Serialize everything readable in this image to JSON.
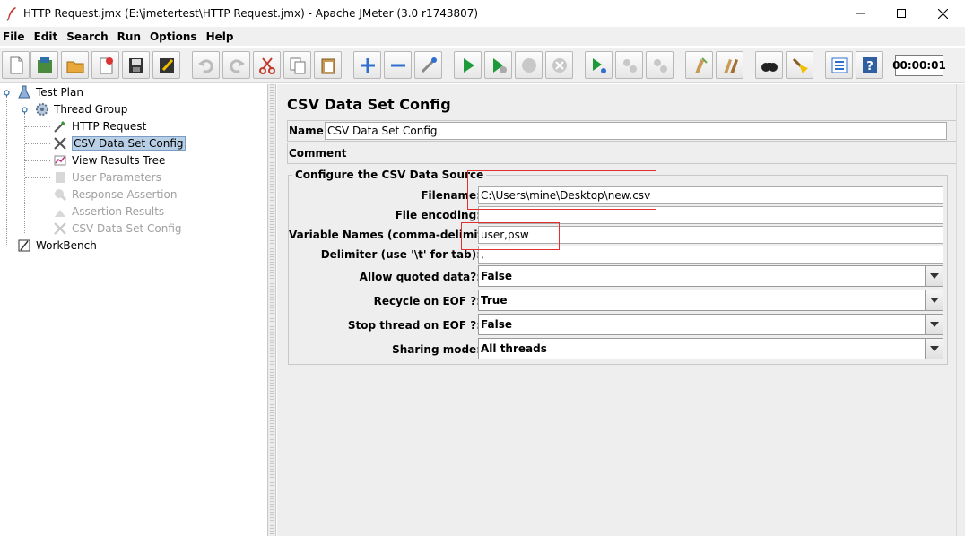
{
  "window": {
    "title": "HTTP Request.jmx (E:\\jmetertest\\HTTP Request.jmx) - Apache JMeter (3.0 r1743807)"
  },
  "menu": [
    "File",
    "Edit",
    "Search",
    "Run",
    "Options",
    "Help"
  ],
  "toolbar": {
    "buttons": [
      "new-icon",
      "templates-icon",
      "open-icon",
      "close-file-icon",
      "save-icon",
      "save-as-icon",
      "undo-icon",
      "redo-icon",
      "cut-icon",
      "copy-icon",
      "paste-icon",
      "expand-icon",
      "collapse-icon",
      "toggle-icon",
      "start-icon",
      "start-no-pause-icon",
      "stop-icon",
      "shutdown-icon",
      "remote-start-icon",
      "remote-stop-icon",
      "remote-shutdown-icon",
      "clear-icon",
      "clear-all-icon",
      "search-icon",
      "reset-search-icon",
      "function-helper-icon",
      "help-icon"
    ],
    "timer": "00:00:01"
  },
  "tree": {
    "items": [
      {
        "label": "Test Plan",
        "icon": "test-plan-icon",
        "enabled": true,
        "selected": false
      },
      {
        "label": "Thread Group",
        "icon": "thread-group-icon",
        "enabled": true,
        "selected": false
      },
      {
        "label": "HTTP Request",
        "icon": "sampler-icon",
        "enabled": true,
        "selected": false
      },
      {
        "label": "CSV Data Set Config",
        "icon": "config-element-icon",
        "enabled": true,
        "selected": true
      },
      {
        "label": "View Results Tree",
        "icon": "listener-icon",
        "enabled": true,
        "selected": false
      },
      {
        "label": "User Parameters",
        "icon": "preprocessor-icon",
        "enabled": false,
        "selected": false
      },
      {
        "label": "Response Assertion",
        "icon": "assertion-icon",
        "enabled": false,
        "selected": false
      },
      {
        "label": "Assertion Results",
        "icon": "listener-icon",
        "enabled": false,
        "selected": false
      },
      {
        "label": "CSV Data Set Config",
        "icon": "config-element-icon",
        "enabled": false,
        "selected": false
      },
      {
        "label": "WorkBench",
        "icon": "workbench-icon",
        "enabled": true,
        "selected": false
      }
    ]
  },
  "panel": {
    "title": "CSV Data Set Config",
    "name_label": "Name:",
    "name_value": "CSV Data Set Config",
    "comments_label": "Comments:",
    "comments_value": "",
    "section_title": "Configure the CSV Data Source",
    "fields": {
      "filename_label": "Filename:",
      "filename_value": "C:\\Users\\mine\\Desktop\\new.csv",
      "encoding_label": "File encoding:",
      "encoding_value": "",
      "varnames_label": "Variable Names (comma-delimited):",
      "varnames_value": "user,psw",
      "delimiter_label": "Delimiter (use '\\t' for tab):",
      "delimiter_value": ","
    },
    "combos": {
      "quoted_label": "Allow quoted data?:",
      "quoted_value": "False",
      "recycle_label": "Recycle on EOF ?:",
      "recycle_value": "True",
      "stop_label": "Stop thread on EOF ?:",
      "stop_value": "False",
      "sharing_label": "Sharing mode:",
      "sharing_value": "All threads"
    }
  },
  "colors": {
    "selection": "#b8cfe5",
    "annotation_red": "#e03030",
    "panel_bg": "#eeeeee"
  }
}
